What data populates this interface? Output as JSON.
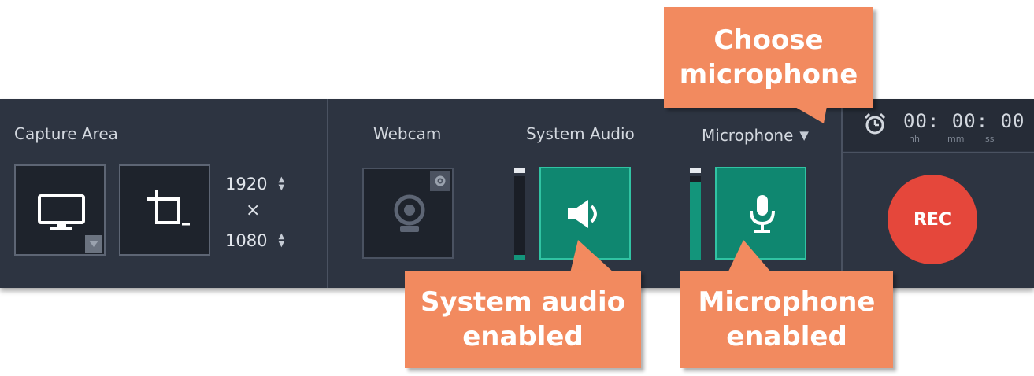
{
  "capture_area": {
    "label": "Capture Area",
    "width": "1920",
    "height": "1080",
    "times": "×"
  },
  "webcam": {
    "label": "Webcam"
  },
  "system_audio": {
    "label": "System Audio"
  },
  "microphone": {
    "label": "Microphone",
    "dropdown_glyph": "▼"
  },
  "timer": {
    "value": "00: 00: 00",
    "unit_h": "hh",
    "unit_m": "mm",
    "unit_s": "ss"
  },
  "rec": {
    "label": "REC"
  },
  "callouts": {
    "choose_line1": "Choose",
    "choose_line2": "microphone",
    "system_line1": "System audio",
    "system_line2": "enabled",
    "mic_line1": "Microphone",
    "mic_line2": "enabled"
  },
  "colors": {
    "toolbar_bg": "#2d3441",
    "audio_active": "#0f8770",
    "rec": "#e5473b",
    "callout": "#f28a5f"
  }
}
